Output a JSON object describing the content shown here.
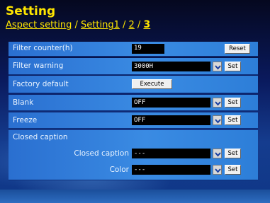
{
  "header": {
    "title": "Setting",
    "breadcrumb": {
      "aspect": "Aspect setting",
      "sep1": " / ",
      "setting1": "Setting1",
      "sep2": " / ",
      "page2": "2",
      "sep3": " / ",
      "page3": "3"
    }
  },
  "rows": {
    "filter_counter": {
      "label": "Filter counter(h)",
      "value": "19",
      "button": "Reset"
    },
    "filter_warning": {
      "label": "Filter warning",
      "value": "3000H",
      "button": "Set"
    },
    "factory_default": {
      "label": "Factory default",
      "button": "Execute"
    },
    "blank": {
      "label": "Blank",
      "value": "OFF",
      "button": "Set"
    },
    "freeze": {
      "label": "Freeze",
      "value": "OFF",
      "button": "Set"
    },
    "closed_caption_header": {
      "label": "Closed caption"
    },
    "closed_caption": {
      "label": "Closed caption",
      "value": "---",
      "button": "Set"
    },
    "color": {
      "label": "Color",
      "value": "---",
      "button": "Set"
    }
  },
  "icons": {
    "dropdown": "chevron-down-icon"
  },
  "colors": {
    "title": "#ffe600",
    "row_bg": "#3a8be3",
    "field_bg": "#000000"
  }
}
